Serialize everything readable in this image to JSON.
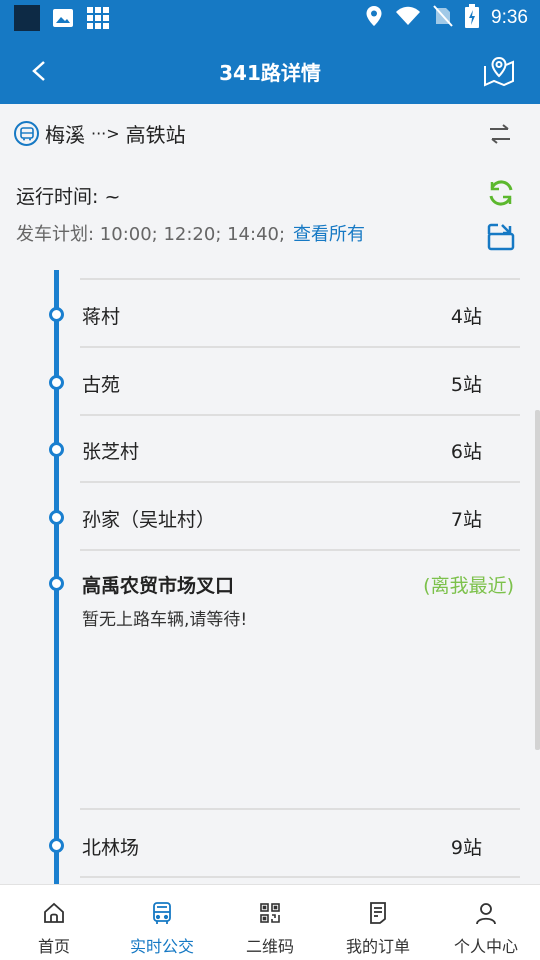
{
  "status_bar": {
    "time": "9:36"
  },
  "app_bar": {
    "title": "341路详情"
  },
  "route": {
    "from": "梅溪",
    "arrow": "···>",
    "to": "高铁站",
    "run_time": "运行时间: ~",
    "schedule": "发车计划: 10:00; 12:20; 14:40;",
    "see_all": "查看所有"
  },
  "stops": [
    {
      "name": "蒋村",
      "count": "4站"
    },
    {
      "name": "古苑",
      "count": "5站"
    },
    {
      "name": "张芝村",
      "count": "6站"
    },
    {
      "name": "孙家（吴址村）",
      "count": "7站"
    },
    {
      "name": "高禹农贸市场叉口",
      "nearest": "(离我最近)",
      "note": "暂无上路车辆,请等待!"
    },
    {
      "name": "北林场",
      "count": "9站"
    }
  ],
  "nav": [
    {
      "label": "首页",
      "icon": "home-icon"
    },
    {
      "label": "实时公交",
      "icon": "bus-icon"
    },
    {
      "label": "二维码",
      "icon": "qr-code-icon"
    },
    {
      "label": "我的订单",
      "icon": "order-icon"
    },
    {
      "label": "个人中心",
      "icon": "person-icon"
    }
  ],
  "colors": {
    "primary": "#1679c4",
    "nearest": "#7cc14b",
    "refresh": "#5cb82e"
  }
}
